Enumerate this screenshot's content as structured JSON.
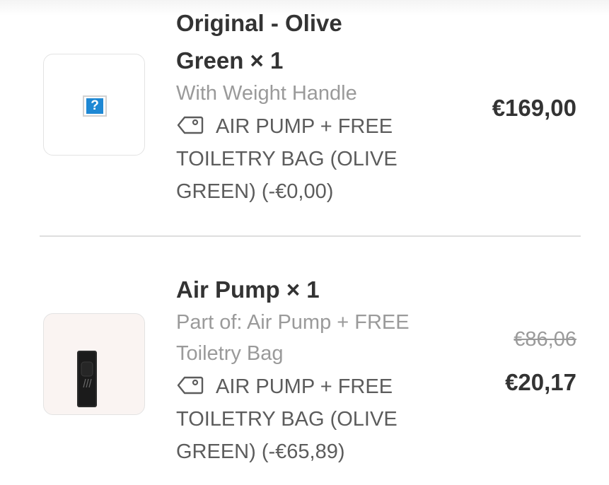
{
  "items": [
    {
      "title": "Original - Olive Green × 1",
      "variant": "With Weight Handle",
      "discount": "AIR PUMP + FREE TOILETRY BAG (OLIVE GREEN) (-€0,00)",
      "price": "€169,00",
      "image": "broken-image-icon"
    },
    {
      "title": "Air Pump × 1",
      "variant": "Part of: Air Pump + FREE Toiletry Bag",
      "discount": "AIR PUMP + FREE TOILETRY BAG (OLIVE GREEN) (-€65,89)",
      "original_price": "€86,06",
      "price": "€20,17",
      "image": "air-pump-product-photo"
    }
  ],
  "icons": {
    "discount": "tag-icon"
  },
  "colors": {
    "text_primary": "#333333",
    "text_secondary": "#9a9a9a",
    "discount_text": "#5c5c5c",
    "divider": "#dedede",
    "broken_image_blue": "#1e88d4"
  }
}
